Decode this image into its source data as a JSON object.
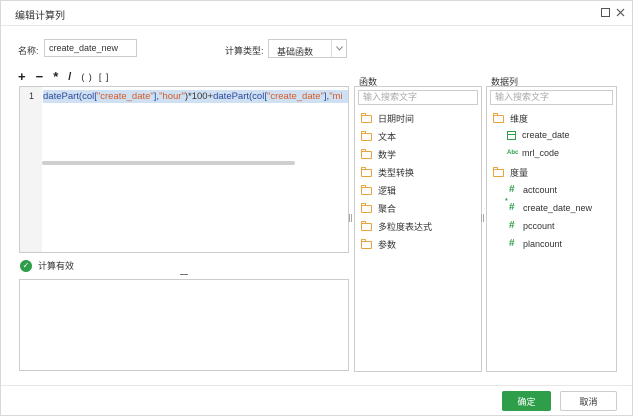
{
  "dialog": {
    "title": "编辑计算列"
  },
  "form": {
    "name_label": "名称:",
    "name_value": "create_date_new",
    "calc_type_label": "计算类型:",
    "calc_type_value": "基础函数"
  },
  "operators": [
    "+",
    "−",
    "*",
    "/",
    "( )",
    "[ ]"
  ],
  "editor": {
    "line_number": "1",
    "code_tokens": [
      {
        "t": "datePart(col[",
        "c": "fn"
      },
      {
        "t": "\"create_date\"",
        "c": "str"
      },
      {
        "t": "],",
        "c": "fn"
      },
      {
        "t": "\"hour\"",
        "c": "str"
      },
      {
        "t": ")*100+",
        "c": "num"
      },
      {
        "t": "datePart(col[",
        "c": "fn"
      },
      {
        "t": "\"create_date\"",
        "c": "str"
      },
      {
        "t": "],",
        "c": "fn"
      },
      {
        "t": "\"mi",
        "c": "str"
      }
    ]
  },
  "status": {
    "valid_text": "计算有效"
  },
  "functions_panel": {
    "header": "函数",
    "search_placeholder": "输入搜索文字",
    "items": [
      "日期时间",
      "文本",
      "数学",
      "类型转换",
      "逻辑",
      "聚合",
      "多粒度表达式",
      "参数"
    ]
  },
  "columns_panel": {
    "header": "数据列",
    "search_placeholder": "输入搜索文字",
    "dimension_label": "维度",
    "dimensions": [
      {
        "name": "create_date",
        "icon": "date-icon"
      },
      {
        "name": "mrl_code",
        "icon": "abc-icon"
      }
    ],
    "measure_label": "度量",
    "measures": [
      {
        "name": "actcount",
        "icon": "hash-icon"
      },
      {
        "name": "create_date_new",
        "icon": "calc-hash-icon"
      },
      {
        "name": "pccount",
        "icon": "hash-icon"
      },
      {
        "name": "plancount",
        "icon": "hash-icon"
      }
    ]
  },
  "buttons": {
    "ok": "确定",
    "cancel": "取消"
  },
  "colors": {
    "accent": "#2e9e4a",
    "folder": "#e8a33c",
    "code_function": "#2b4a9b",
    "code_string": "#d35c2c",
    "selection": "#cfe0f3"
  }
}
